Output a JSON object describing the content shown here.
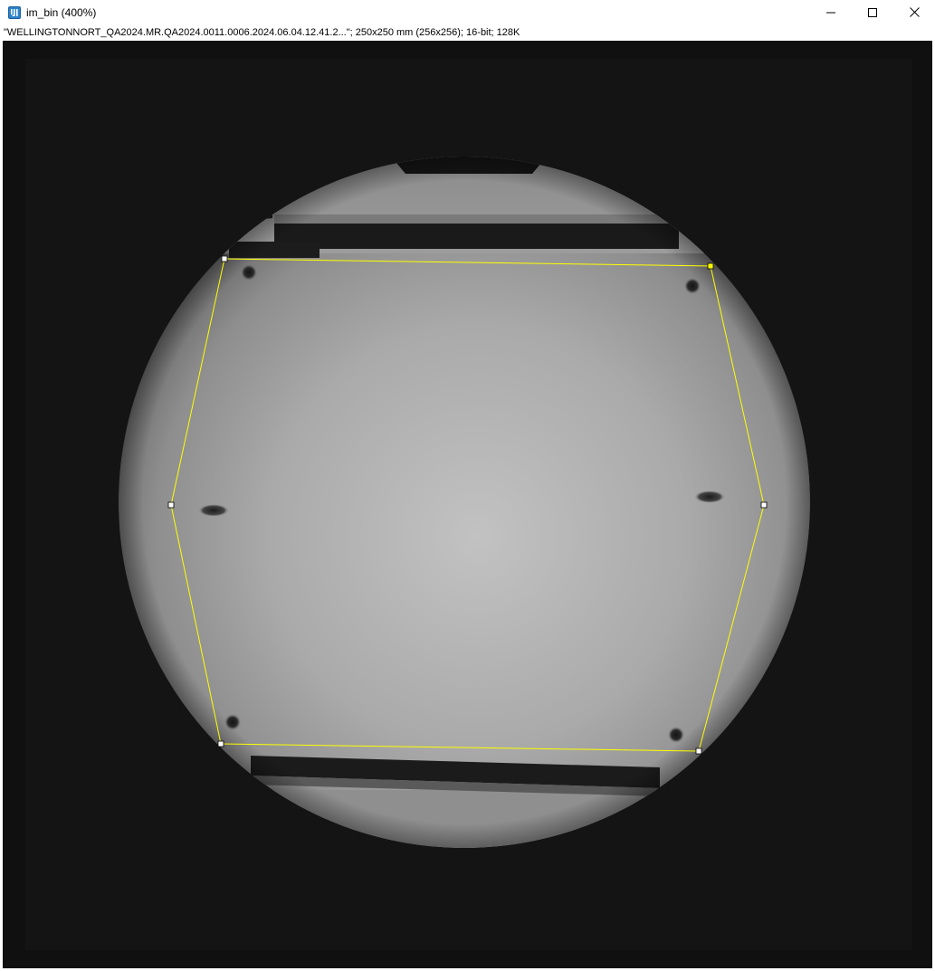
{
  "window": {
    "title": "im_bin (400%)",
    "app_icon": "imagej-icon",
    "controls": {
      "minimize": "minimize-icon",
      "maximize": "maximize-icon",
      "close": "close-icon"
    }
  },
  "image_info": {
    "text": "\"WELLINGTONNORT_QA2024.MR.QA2024.0011.0006.2024.06.04.12.41.2...\"; 250x250 mm (256x256); 16-bit; 128K"
  },
  "canvas": {
    "background": "#101010",
    "roi": {
      "type": "polygon",
      "color": "#ffff00",
      "vertex_count": 6
    }
  }
}
